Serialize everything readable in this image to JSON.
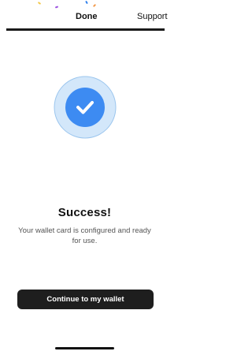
{
  "nav": {
    "done_label": "Done",
    "support_label": "Support"
  },
  "success": {
    "title": "Success!",
    "message": "Your wallet card is configured and ready for use."
  },
  "actions": {
    "continue_label": "Continue to my wallet"
  },
  "colors": {
    "accent": "#3d8bf2",
    "halo": "#cfe4f8",
    "button_bg": "#1e1e1e"
  },
  "icons": {
    "success": "checkmark-icon"
  }
}
